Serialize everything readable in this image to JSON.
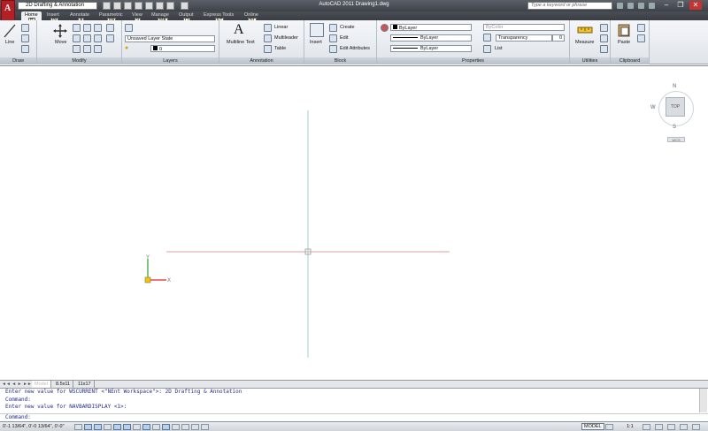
{
  "titlebar": {
    "workspace": "2D Drafting & Annotation",
    "window_title": "AutoCAD 2011    Drawing1.dwg",
    "search_placeholder": "Type a keyword or phrase"
  },
  "tabs": [
    {
      "label": "Home",
      "key": "H"
    },
    {
      "label": "Insert",
      "key": "IN"
    },
    {
      "label": "Annotate",
      "key": "A"
    },
    {
      "label": "Parametric",
      "key": "PA"
    },
    {
      "label": "View",
      "key": "V"
    },
    {
      "label": "Manage",
      "key": "MA"
    },
    {
      "label": "Output",
      "key": "O"
    },
    {
      "label": "Express Tools",
      "key": "ET"
    },
    {
      "label": "Online",
      "key": "NL"
    }
  ],
  "ribbon": {
    "draw": {
      "title": "Draw",
      "line": "Line"
    },
    "modify": {
      "title": "Modify",
      "move": "Move"
    },
    "layers": {
      "title": "Layers",
      "state": "Unsaved Layer State",
      "current": "0"
    },
    "annotation": {
      "title": "Annotation",
      "mtext": "Multiline Text",
      "linear": "Linear",
      "mleader": "Multileader",
      "table": "Table"
    },
    "block": {
      "title": "Block",
      "insert": "Insert",
      "create": "Create",
      "edit": "Edit",
      "edit_attr": "Edit Attributes"
    },
    "properties": {
      "title": "Properties",
      "color": "ByLayer",
      "linetype": "ByLayer",
      "lineweight": "ByLayer",
      "plotstyle": "ByColor",
      "transparency": "Transparency",
      "transparency_value": "0",
      "list": "List"
    },
    "utilities": {
      "title": "Utilities",
      "measure": "Measure"
    },
    "clipboard": {
      "title": "Clipboard",
      "paste": "Paste"
    }
  },
  "viewcube": {
    "n": "N",
    "s": "S",
    "w": "W",
    "top": "TOP",
    "wcs": "WCS"
  },
  "layout_tabs": [
    "Model",
    "8.5x11",
    "11x17"
  ],
  "command_lines": [
    "Enter new value for WSCURRENT <\"NEnt Workspace\">: 2D Drafting & Annotation",
    "Command:",
    "Enter new value for NAVBARDISPLAY <1>:"
  ],
  "command_prompt": "Command:",
  "status": {
    "coords": "0'-1 13/64\", 0'-0 13/64\", 0'-0\"",
    "model": "MODEL",
    "scale": "1:1"
  },
  "colors": {
    "app_red": "#b22025",
    "crosshair_v": "#9fd6c8",
    "crosshair_h": "#d9a0a0",
    "cmd_text": "#222c8a"
  }
}
